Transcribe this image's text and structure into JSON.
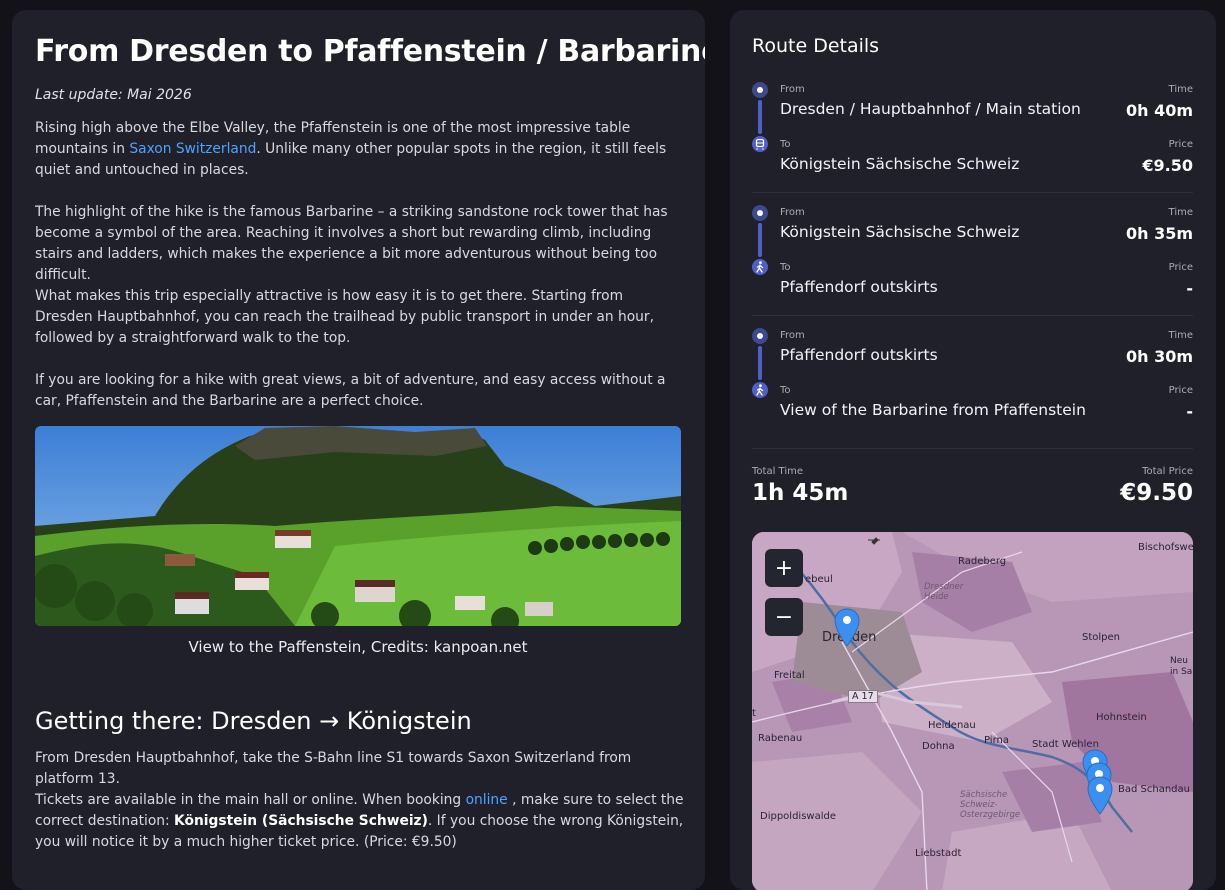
{
  "article": {
    "title": "From Dresden to Pfaffenstein / Barbarine",
    "updated": "Last update: Mai 2026",
    "p1_a": "Rising high above the Elbe Valley, the Pfaffenstein is one of the most impressive table mountains in",
    "p1_link": "Saxon Switzerland",
    "p1_b": ". Unlike many other popular spots in the region, it still feels quiet and untouched in places.",
    "p2": "The highlight of the hike is the famous Barbarine – a striking sandstone rock tower that has become a symbol of the area. Reaching it involves a short but rewarding climb, including stairs and ladders, which makes the experience a bit more adventurous without being too difficult.",
    "p3": "What makes this trip especially attractive is how easy it is to get there. Starting from Dresden Hauptbahnhof, you can reach the trailhead by public transport in under an hour, followed by a straightforward walk to the top.",
    "p4": "If you are looking for a hike with great views, a bit of adventure, and easy access without a car, Pfaffenstein and the Barbarine are a perfect choice.",
    "caption": "View to the Paffenstein, Credits: kanpoan.net",
    "h2": "Getting there: Dresden → Königstein",
    "p5": "From Dresden Hauptbahnhof, take the S-Bahn line S1 towards Saxon Switzerland from platform 13.",
    "p6_a": "Tickets are available in the main hall or online. When booking",
    "p6_link": "online",
    "p6_b": ", make sure to select the correct destination:",
    "p6_bold": "Königstein (Sächsische Schweiz)",
    "p6_c": ". If you choose the wrong Königstein, you will notice it by a much higher ticket price. (Price: €9.50)"
  },
  "route": {
    "title": "Route Details",
    "from_label": "From",
    "to_label": "To",
    "time_label": "Time",
    "price_label": "Price",
    "legs": [
      {
        "from": "Dresden / Hauptbahnhof / Main station",
        "to": "Königstein Sächsische Schweiz",
        "time": "0h 40m",
        "price": "€9.50",
        "mode": "train-icon"
      },
      {
        "from": "Königstein Sächsische Schweiz",
        "to": "Pfaffendorf outskirts",
        "time": "0h 35m",
        "price": "-",
        "mode": "walk-icon"
      },
      {
        "from": "Pfaffendorf outskirts",
        "to": "View of the Barbarine from Pfaffenstein",
        "time": "0h 30m",
        "price": "-",
        "mode": "walk-icon"
      }
    ],
    "total_time_label": "Total Time",
    "total_time": "1h 45m",
    "total_price_label": "Total Price",
    "total_price": "€9.50"
  },
  "map": {
    "zoom_in": "+",
    "zoom_out": "−",
    "labels": {
      "bischofswerda": "Bischofswer",
      "radeberg": "Radeberg",
      "dresdner_heide": "Dresdner Heide",
      "radebeul": "ebeul",
      "dresden": "Dresden",
      "stolpen": "Stolpen",
      "freital": "Freital",
      "a17": "A 17",
      "neustadt": "Neu in Sa",
      "heidenau": "Heidenau",
      "rabenau": "Rabenau",
      "dohna": "Dohna",
      "pirna": "Pirna",
      "stadt_wehlen": "Stadt Wehlen",
      "hohnstein": "Hohnstein",
      "bad_schandau": "Bad Schandau",
      "saechsische_schweiz": "Sächsische Schweiz-Osterzgebirge",
      "dippoldiswalde": "Dippoldiswalde",
      "liebstadt": "Liebstadt",
      "t": "t"
    }
  },
  "colors": {
    "accent": "#4f61c8",
    "link": "#4ea3ff",
    "panel": "#1f2029",
    "page": "#121218"
  }
}
